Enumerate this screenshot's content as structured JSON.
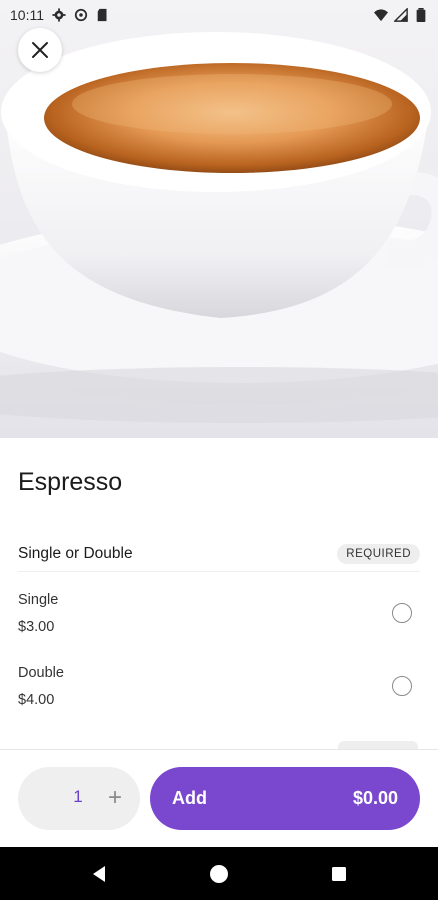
{
  "status_bar": {
    "time": "10:11",
    "left_icons": [
      "gear-icon",
      "sync-icon",
      "sd-card-icon"
    ],
    "right_icons": [
      "wifi-icon",
      "signal-icon",
      "battery-icon"
    ]
  },
  "hero": {
    "image": "espresso-cup-photo"
  },
  "product": {
    "title": "Espresso"
  },
  "modifier_group": {
    "label": "Single or Double",
    "badge": "REQUIRED",
    "options": [
      {
        "name": "Single",
        "price": "$3.00",
        "selected": false
      },
      {
        "name": "Double",
        "price": "$4.00",
        "selected": false
      }
    ]
  },
  "footer": {
    "quantity": "1",
    "plus_label": "+",
    "add_label": "Add",
    "total": "$0.00"
  },
  "colors": {
    "accent": "#7a48cf",
    "qty_text": "#6a40c8"
  }
}
